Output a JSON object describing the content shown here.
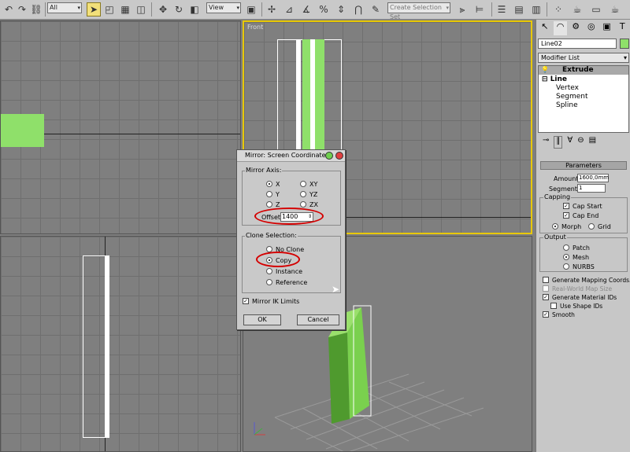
{
  "toolbar": {
    "filter_value": "All",
    "refcoord_value": "View",
    "selection_set_placeholder": "Create Selection Set",
    "icons": [
      "undo-icon",
      "redo-icon",
      "link-icon",
      "unlink-icon",
      "bind-icon",
      "select-cursor-icon",
      "select-region-icon",
      "select-name-icon",
      "window-crossing-icon",
      "move-icon",
      "rotate-icon",
      "scale-icon",
      "pivot-icon",
      "select-manipulate-icon",
      "snap-icon",
      "angle-snap-icon",
      "percent-snap-icon",
      "spinner-snap-icon",
      "edit-named-selection-icon",
      "mirror-icon",
      "align-icon",
      "layer-manager-icon",
      "curve-editor-icon",
      "schematic-icon",
      "material-editor-icon",
      "render-setup-icon",
      "render-icon"
    ]
  },
  "viewports": {
    "front_label": "Front"
  },
  "command_panel": {
    "object_name": "Line02",
    "modifier_list_label": "Modifier List",
    "stack": [
      {
        "label": "Extrude",
        "selected": true
      },
      {
        "label": "Line",
        "selected": false
      },
      {
        "label": "Vertex",
        "selected": false
      },
      {
        "label": "Segment",
        "selected": false
      },
      {
        "label": "Spline",
        "selected": false
      }
    ],
    "parameters_title": "Parameters",
    "amount_label": "Amount:",
    "amount_value": "1600,0mm",
    "segments_label": "Segments:",
    "segments_value": "1",
    "capping_title": "Capping",
    "cap_start_label": "Cap Start",
    "cap_end_label": "Cap End",
    "morph_label": "Morph",
    "grid_label": "Grid",
    "output_title": "Output",
    "patch_label": "Patch",
    "mesh_label": "Mesh",
    "nurbs_label": "NURBS",
    "gen_mapping_label": "Generate Mapping Coords.",
    "real_world_label": "Real-World Map Size",
    "gen_material_label": "Generate Material IDs",
    "use_shape_label": "Use Shape IDs",
    "smooth_label": "Smooth"
  },
  "mirror_dialog": {
    "title": "Mirror: Screen Coordinates",
    "mirror_axis_title": "Mirror Axis:",
    "axes": [
      "X",
      "Y",
      "Z",
      "XY",
      "YZ",
      "ZX"
    ],
    "selected_axis": "X",
    "offset_label": "Offset:",
    "offset_value": "1400",
    "clone_title": "Clone Selection:",
    "clone_options": [
      "No Clone",
      "Copy",
      "Instance",
      "Reference"
    ],
    "selected_clone": "Copy",
    "mirror_ik_label": "Mirror IK Limits",
    "ok_label": "OK",
    "cancel_label": "Cancel"
  },
  "colors": {
    "object_green": "#8fe06a",
    "active_viewport_border": "#e8c800",
    "annotation_red": "#d40000"
  }
}
